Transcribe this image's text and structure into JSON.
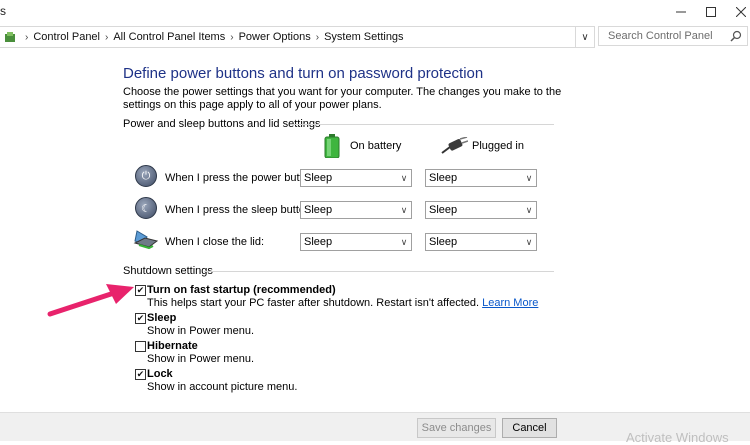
{
  "window": {
    "title": "s",
    "controls": [
      "minimize",
      "maximize",
      "close"
    ]
  },
  "address_bar": {
    "breadcrumbs": [
      "Control Panel",
      "All Control Panel Items",
      "Power Options",
      "System Settings"
    ],
    "search_placeholder": "Search Control Panel"
  },
  "page": {
    "heading": "Define power buttons and turn on password protection",
    "description": "Choose the power settings that you want for your computer. The changes you make to the settings on this page apply to all of your power plans."
  },
  "power_section": {
    "label": "Power and sleep buttons and lid settings",
    "columns": [
      "On battery",
      "Plugged in"
    ],
    "rows": [
      {
        "label": "When I press the power button:",
        "battery": "Sleep",
        "plugged": "Sleep",
        "icon": "power-button-icon"
      },
      {
        "label": "When I press the sleep button:",
        "battery": "Sleep",
        "plugged": "Sleep",
        "icon": "sleep-button-icon"
      },
      {
        "label": "When I close the lid:",
        "battery": "Sleep",
        "plugged": "Sleep",
        "icon": "laptop-lid-icon"
      }
    ]
  },
  "shutdown_section": {
    "label": "Shutdown settings",
    "options": [
      {
        "title": "Turn on fast startup (recommended)",
        "desc": "This helps start your PC faster after shutdown. Restart isn't affected.",
        "link": "Learn More",
        "checked": true
      },
      {
        "title": "Sleep",
        "desc": "Show in Power menu.",
        "checked": true
      },
      {
        "title": "Hibernate",
        "desc": "Show in Power menu.",
        "checked": false
      },
      {
        "title": "Lock",
        "desc": "Show in account picture menu.",
        "checked": true
      }
    ]
  },
  "buttons": {
    "save": "Save changes",
    "cancel": "Cancel"
  },
  "watermark": "Activate Windows",
  "colors": {
    "heading": "#1e3287",
    "link": "#0a58ca",
    "arrow": "#e8236c"
  }
}
